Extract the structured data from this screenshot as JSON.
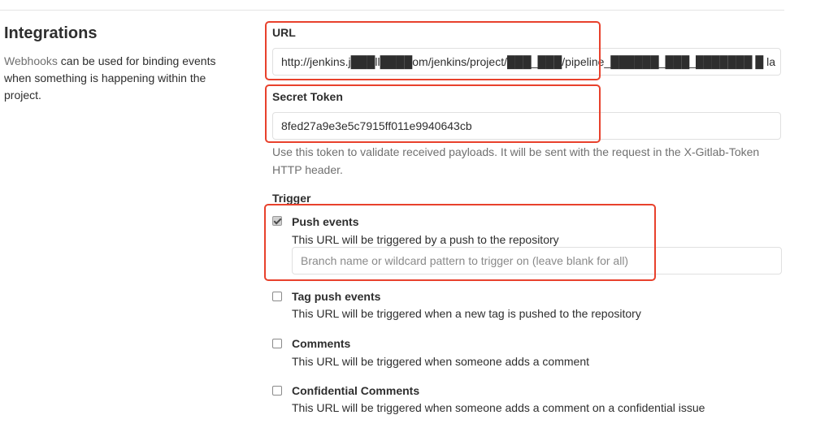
{
  "section": {
    "title": "Integrations",
    "desc_link": "Webhooks",
    "desc_text": " can be used for binding events when something is happening within the project."
  },
  "url_field": {
    "label": "URL",
    "value": "http://jenkins.j███ll████om/jenkins/project/███_███/pipeline_██████_███_███████ █ la"
  },
  "secret_token_field": {
    "label": "Secret Token",
    "value": "8fed27a9e3e5c7915ff011e9940643cb",
    "help": "Use this token to validate received payloads. It will be sent with the request in the X-Gitlab-Token HTTP header."
  },
  "trigger": {
    "label": "Trigger",
    "options": [
      {
        "title": "Push events",
        "desc": "This URL will be triggered by a push to the repository",
        "checked": true,
        "branch_placeholder": "Branch name or wildcard pattern to trigger on (leave blank for all)"
      },
      {
        "title": "Tag push events",
        "desc": "This URL will be triggered when a new tag is pushed to the repository",
        "checked": false
      },
      {
        "title": "Comments",
        "desc": "This URL will be triggered when someone adds a comment",
        "checked": false
      },
      {
        "title": "Confidential Comments",
        "desc": "This URL will be triggered when someone adds a comment on a confidential issue",
        "checked": false
      }
    ]
  },
  "colors": {
    "highlight": "#e8412c",
    "link": "#707070",
    "help_text": "#707070"
  }
}
